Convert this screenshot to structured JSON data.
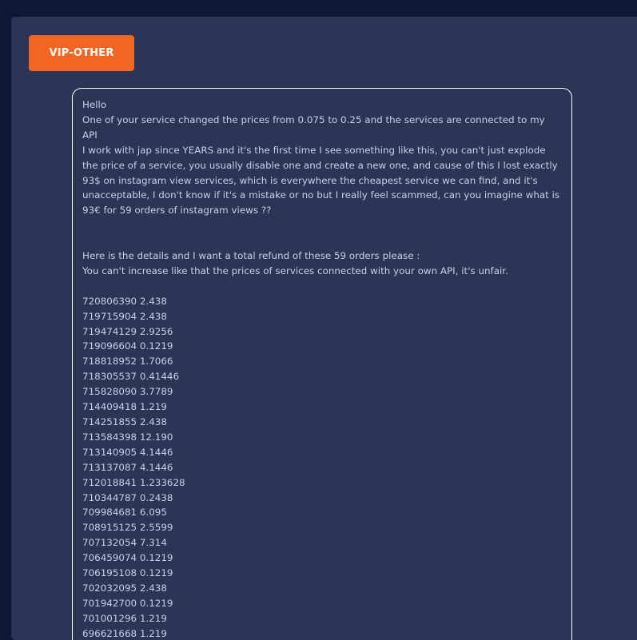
{
  "category_badge": "VIP-OTHER",
  "message": {
    "greeting": "Hello",
    "line1": "One of your service changed the prices from 0.075 to 0.25 and the services are connected to my API",
    "paragraph1": "I work with jap since YEARS and it's the first time I see something like this, you can't just explode the price of a service, you usually disable one and create a new one, and cause of this I lost exactly 93$ on instagram view services, which is everywhere the cheapest service we can find, and it's unacceptable, I don't know if it's a mistake or no but I really feel scammed, can you imagine what is 93€ for 59 orders of instagram views ??",
    "line2": "Here is the details and I want a total refund of these 59 orders please :",
    "line3": "You can't increase like that the prices of services connected with your own API, it's unfair.",
    "orders": [
      "720806390 2.438",
      "719715904 2.438",
      "719474129 2.9256",
      "719096604 0.1219",
      "718818952 1.7066",
      "718305537 0.41446",
      "715828090 3.7789",
      "714409418 1.219",
      "714251855 2.438",
      "713584398 12.190",
      "713140905 4.1446",
      "713137087 4.1446",
      "712018841 1.233628",
      "710344787 0.2438",
      "709984681 6.095",
      "708915125 2.5599",
      "707132054 7.314",
      "706459074 0.1219",
      "706195108 0.1219",
      "702032095 2.438",
      "701942700 0.1219",
      "701001296 1.219",
      "696621668 1.219"
    ]
  }
}
